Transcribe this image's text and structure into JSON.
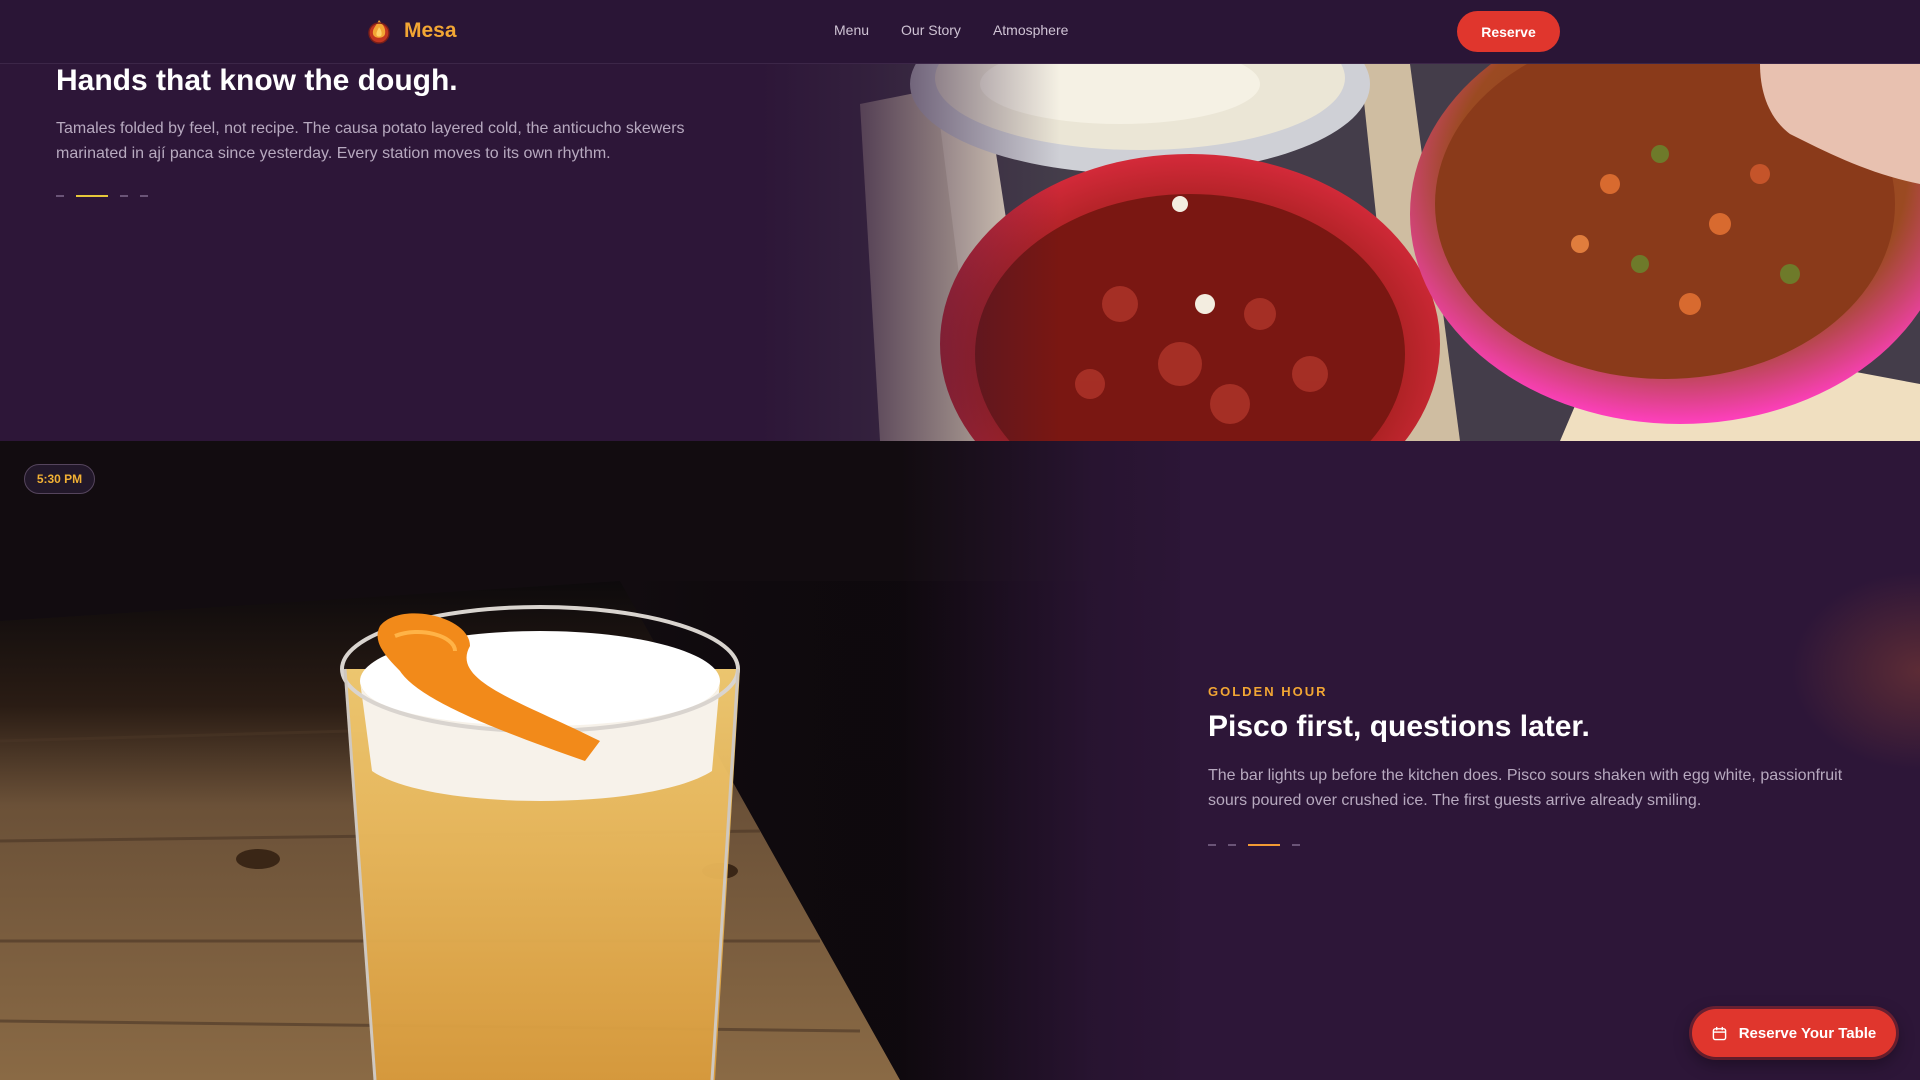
{
  "brand": {
    "name": "Mesa",
    "icon": "flame-logo-icon"
  },
  "nav": {
    "items": [
      {
        "label": "Menu"
      },
      {
        "label": "Our Story"
      },
      {
        "label": "Atmosphere"
      }
    ],
    "reserve_label": "Reserve"
  },
  "sections": [
    {
      "title": "Hands that know the dough.",
      "description": "Tamales folded by feel, not recipe. The causa potato layered cold, the anticucho skewers marinated in ají panca since yesterday. Every station moves to its own rhythm.",
      "slide_index": 2,
      "slide_count": 4
    },
    {
      "time": "5:30 PM",
      "eyebrow": "GOLDEN HOUR",
      "title": "Pisco first, questions later.",
      "description": "The bar lights up before the kitchen does. Pisco sours shaken with egg white, passionfruit sours poured over crushed ice. The first guests arrive already smiling.",
      "slide_index": 3,
      "slide_count": 4
    }
  ],
  "floating_cta": {
    "label": "Reserve Your Table",
    "icon": "calendar-icon"
  },
  "colors": {
    "background": "#2d1638",
    "accent_orange": "#f2a634",
    "cta_red": "#e0362d",
    "dot_yellow": "#e6c73a"
  }
}
